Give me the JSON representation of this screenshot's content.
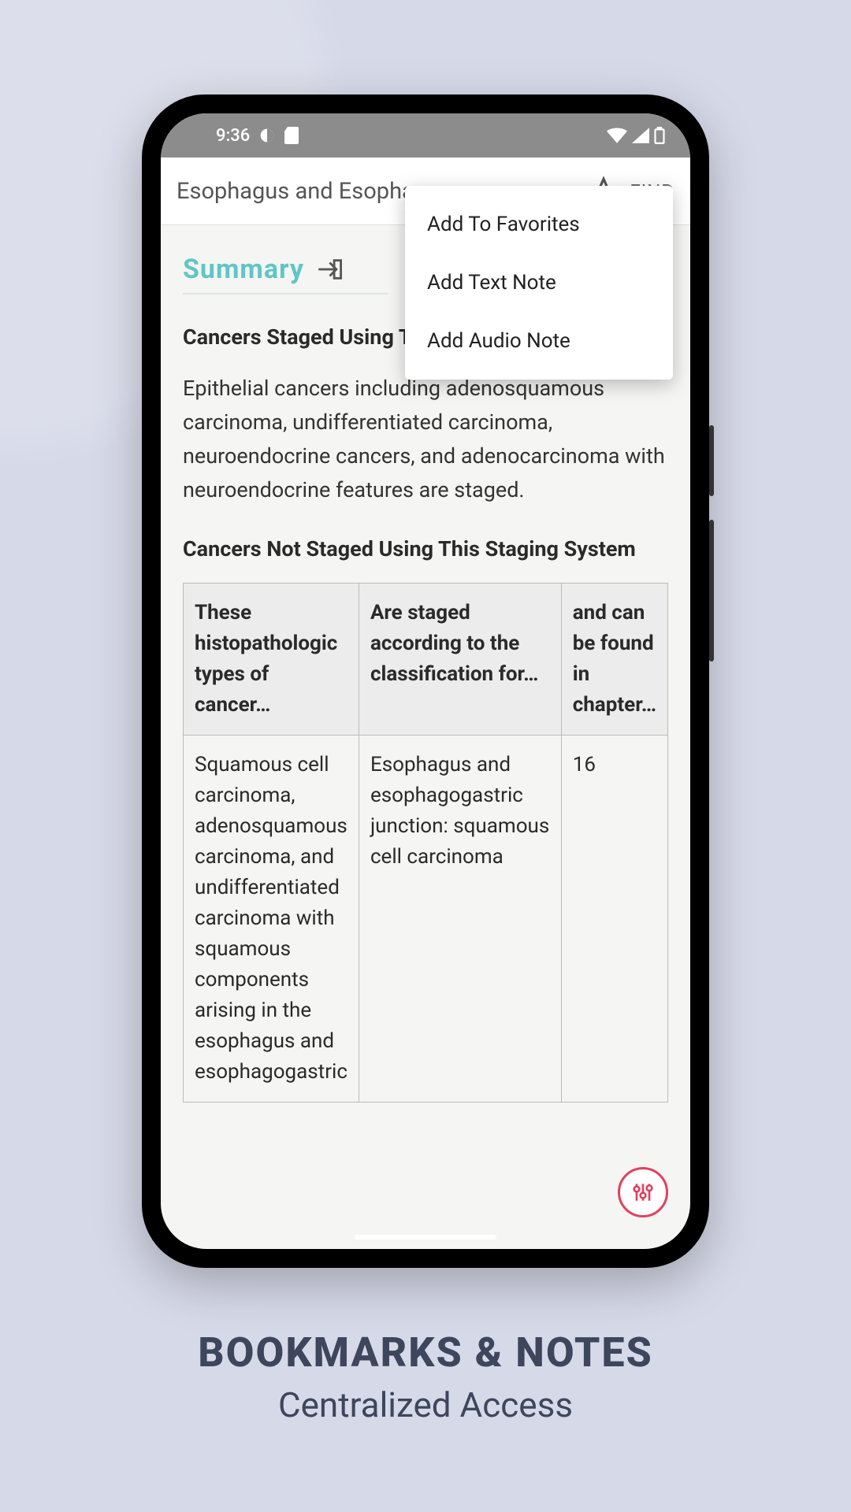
{
  "status": {
    "time": "9:36"
  },
  "topbar": {
    "title": "Esophagus and Esophagoga…",
    "find_label": "FIND"
  },
  "popup": {
    "items": [
      {
        "label": "Add To Favorites"
      },
      {
        "label": "Add Text Note"
      },
      {
        "label": "Add Audio Note"
      }
    ]
  },
  "content": {
    "summary_label": "Summary",
    "section1_title": "Cancers Staged Using This",
    "body1": "Epithelial cancers including adenosquamous carcinoma, undifferentiated carcinoma, neuroendocrine cancers, and adenocarcinoma with neuroendocrine features are staged.",
    "section2_title": "Cancers Not Staged Using This Staging System",
    "table": {
      "headers": [
        "These histopathologic types of cancer…",
        "Are staged according to the classification for…",
        "and can be found in chapter…"
      ],
      "row1": [
        "Squamous cell carcinoma, adenosquamous carcinoma, and undifferentiated carcinoma with squamous components arising in the esophagus and esophagogastric",
        "Esophagus and esophagogastric junction: squamous cell carcinoma",
        "16"
      ]
    }
  },
  "caption": {
    "heading": "BOOKMARKS & NOTES",
    "sub": "Centralized Access"
  }
}
